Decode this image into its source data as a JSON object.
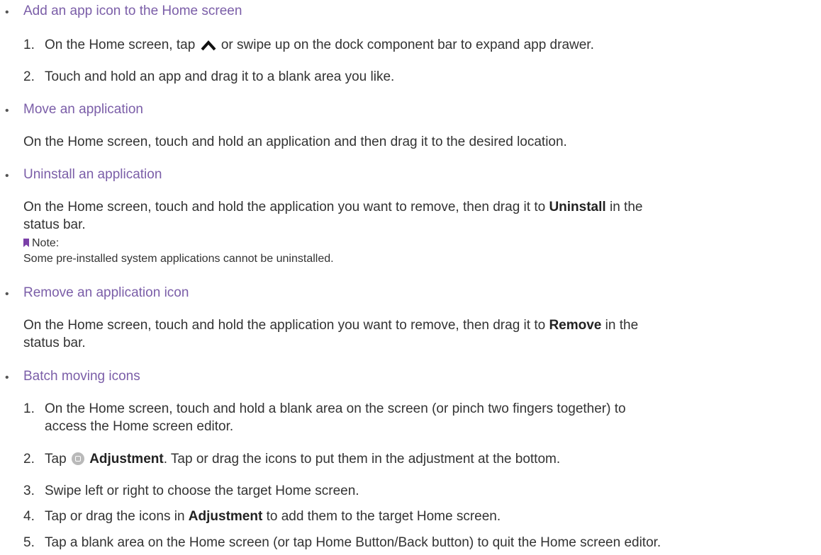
{
  "bullet_glyph": "•",
  "sections": [
    {
      "heading": "Add an app icon to the Home screen",
      "steps": [
        {
          "num": "1.",
          "pre": "On the Home screen, tap",
          "post": "or swipe up on the dock component bar to expand app drawer."
        },
        {
          "num": "2.",
          "text": "Touch and hold an app and drag it to a blank area you like."
        }
      ]
    },
    {
      "heading": "Move an application",
      "body": "On the Home screen, touch and hold an application and then drag it to the desired location."
    },
    {
      "heading": "Uninstall an application",
      "body_pre": "On the Home screen, touch and hold the application you want to remove, then drag it to",
      "body_bold": "Uninstall",
      "body_post": "in the",
      "body_line2": "status bar.",
      "note_label": "Note:",
      "note_text": "Some pre-installed system applications cannot be uninstalled."
    },
    {
      "heading": "Remove an application icon",
      "body_pre": "On the Home screen, touch and hold the application you want to remove, then drag it to",
      "body_bold": "Remove",
      "body_post": "in the",
      "body_line2": "status bar."
    },
    {
      "heading": "Batch moving icons",
      "steps": [
        {
          "num": "1.",
          "line1": "On the Home screen, touch and hold a blank area on the screen (or pinch two fingers together) to",
          "line2": "access the Home screen editor."
        },
        {
          "num": "2.",
          "pre": "Tap",
          "bold": "Adjustment",
          "post": ". Tap or drag the icons to put them in the adjustment at the bottom."
        },
        {
          "num": "3.",
          "text": "Swipe left or right to choose the target Home screen."
        },
        {
          "num": "4.",
          "pre": "Tap or drag the icons in",
          "bold": "Adjustment",
          "post": "to add them to the target Home screen."
        },
        {
          "num": "5.",
          "text": "Tap a blank area on the Home screen (or tap Home Button/Back button) to quit the Home screen editor."
        }
      ]
    }
  ],
  "icons": {
    "expand": "chevron-up-icon",
    "adjustment": "adjustment-icon",
    "note": "bookmark-icon"
  },
  "colors": {
    "heading": "#7b5ea8",
    "text": "#333333",
    "note_marker": "#7b3fa8"
  }
}
